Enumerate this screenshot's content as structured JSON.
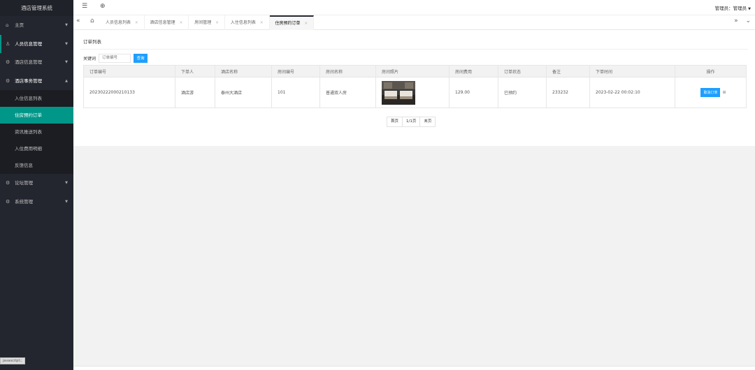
{
  "app": {
    "title": "酒店管理系统"
  },
  "sidebar": {
    "items": [
      {
        "label": "主页",
        "icon": "home-icon"
      },
      {
        "label": "人员信息管理",
        "icon": "user-icon"
      },
      {
        "label": "酒店信息管理",
        "icon": "gear-icon"
      },
      {
        "label": "酒店事务管理",
        "icon": "gear-icon"
      },
      {
        "label": "论坛管理",
        "icon": "gear-icon"
      },
      {
        "label": "系统管理",
        "icon": "gear-icon"
      }
    ],
    "subitems": [
      "入住信息列表",
      "住房预约订单",
      "资讯推送列表",
      "入住费用明细",
      "反馈信息"
    ],
    "status_chip": "javascript:;"
  },
  "header": {
    "admin_label": "管理员：管理员"
  },
  "tabs": [
    "人员信息列表",
    "酒店信息管理",
    "房间管理",
    "入住信息列表",
    "住房预约订单"
  ],
  "content": {
    "card_title": "订单列表",
    "search": {
      "label": "关键词",
      "placeholder": "订单编号",
      "button": "查询"
    },
    "columns": [
      "订单编号",
      "下单人",
      "酒店名称",
      "房间编号",
      "房间名称",
      "房间照片",
      "房间费用",
      "订单状态",
      "备注",
      "下单时间",
      "操作"
    ],
    "rows": [
      {
        "order_no": "20230222000210133",
        "user": "酒店游",
        "hotel": "泰州大酒店",
        "room_no": "101",
        "room_name": "普通双人房",
        "fee": "129.00",
        "status": "已预约",
        "note": "233232",
        "time": "2023-02-22 00:02:10",
        "action": "取消订单"
      }
    ],
    "pager": [
      "首页",
      "1/1页",
      "末页"
    ]
  },
  "colors": {
    "sidebar": "#23262e",
    "accent": "#009688",
    "button": "#1e9fff",
    "status": "#ff3333"
  }
}
